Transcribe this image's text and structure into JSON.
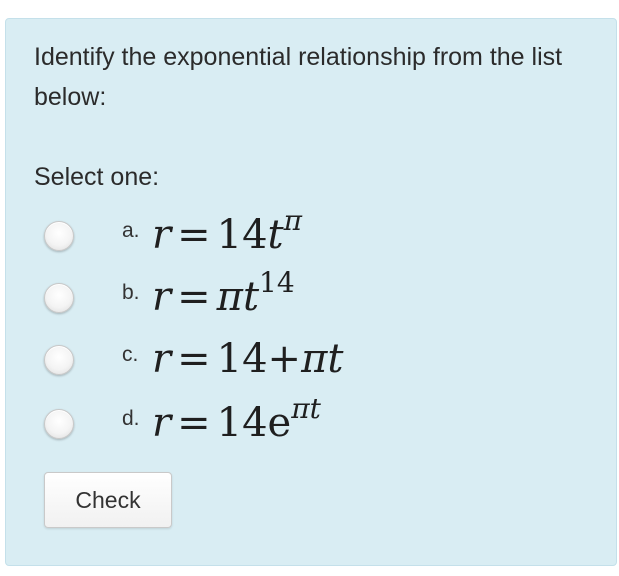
{
  "question": {
    "text": "Identify the exponential relationship from the list below:",
    "select_label": "Select one:"
  },
  "options": [
    {
      "letter": "a.",
      "lhs": "r",
      "eq": "=",
      "parts": [
        "14",
        "t"
      ],
      "sup": "π"
    },
    {
      "letter": "b.",
      "lhs": "r",
      "eq": "=",
      "parts": [
        "π",
        "t"
      ],
      "sup": "14"
    },
    {
      "letter": "c.",
      "lhs": "r",
      "eq": "=",
      "parts": [
        "14",
        "+",
        "π",
        "t"
      ],
      "sup": ""
    },
    {
      "letter": "d.",
      "lhs": "r",
      "eq": "=",
      "parts": [
        "14",
        "e"
      ],
      "sup": "πt"
    }
  ],
  "check_button": {
    "label": "Check"
  },
  "colors": {
    "panel_background": "#d9edf3",
    "panel_border": "#c4e0ea"
  }
}
